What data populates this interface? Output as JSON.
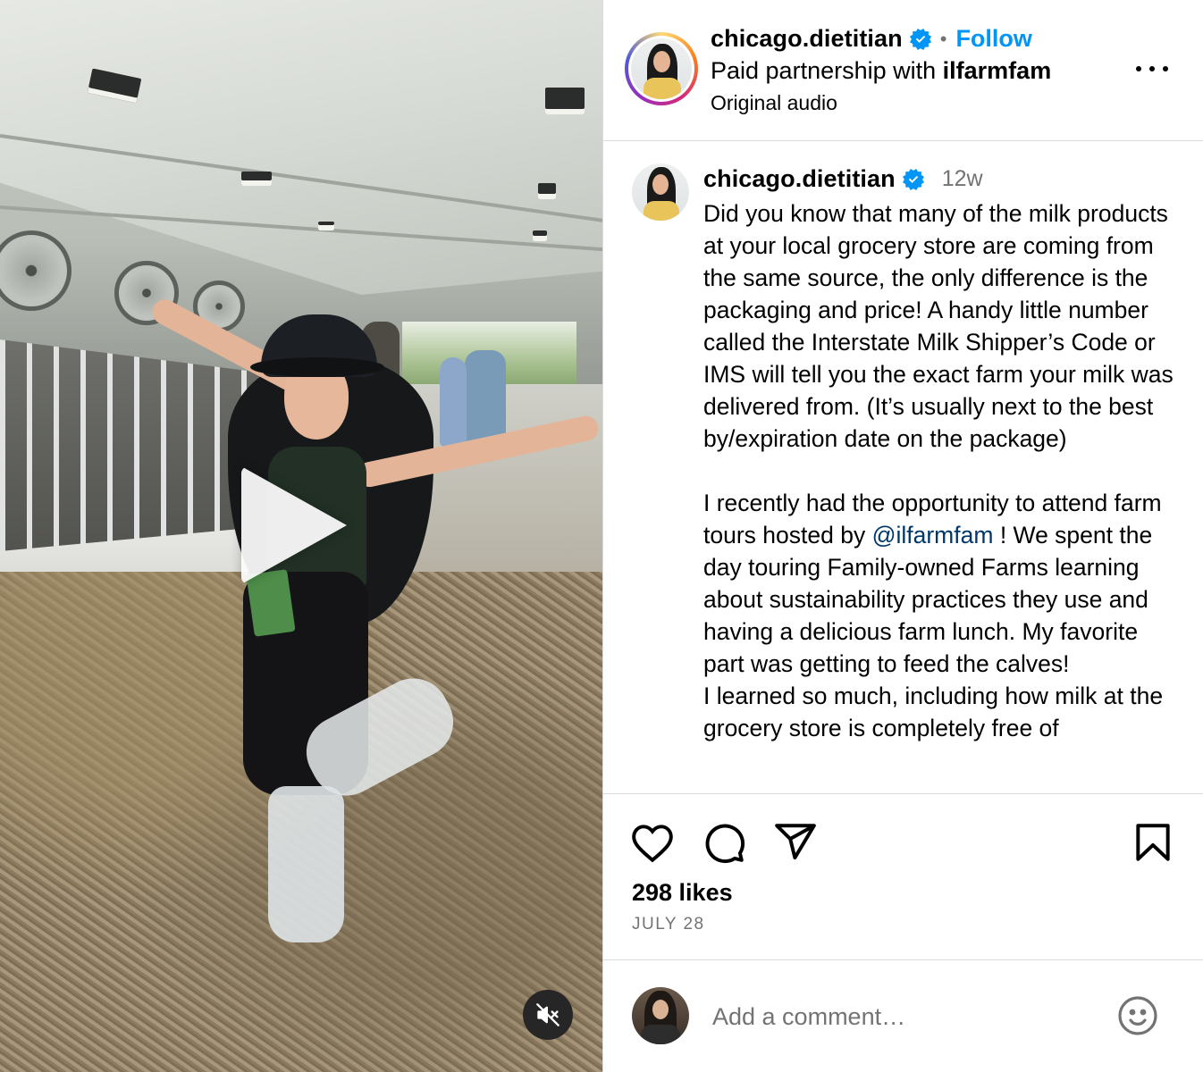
{
  "header": {
    "username": "chicago.dietitian",
    "follow_label": "Follow",
    "separator": "•",
    "partnership_prefix": "Paid partnership with",
    "partner": "ilfarmfam",
    "audio": "Original audio"
  },
  "post": {
    "username": "chicago.dietitian",
    "time": "12w",
    "caption_p1": "Did you know that many of the milk products at your local grocery store are coming from the same source, the only difference is the packaging and price! A handy little number called the Interstate Milk Shipper’s Code or IMS will tell you the exact farm your milk was delivered from. (It’s usually next to the best by/expiration date on the package)",
    "caption_p2_pre": "I recently had the opportunity to attend farm tours hosted by",
    "caption_p2_mention": "@ilfarmfam",
    "caption_p2_post": "! We spent the day touring Family-owned Farms learning about sustainability practices they use and having a delicious farm lunch. My favorite part was getting to feed the calves!",
    "caption_p3": "I learned so much, including how milk at the grocery store is completely free of"
  },
  "stats": {
    "likes": "298 likes",
    "date": "JULY 28"
  },
  "comment": {
    "placeholder": "Add a comment…"
  },
  "icons": {
    "verified": "verified-badge-icon",
    "more": "more-options-icon",
    "like": "heart-icon",
    "comment": "comment-icon",
    "share": "share-icon",
    "save": "bookmark-icon",
    "emoji": "emoji-icon",
    "play": "play-icon",
    "mute": "muted-speaker-icon"
  },
  "colors": {
    "accent": "#0095f6",
    "mention": "#00376b",
    "muted_text": "#737373",
    "divider": "#dbdbdb"
  }
}
